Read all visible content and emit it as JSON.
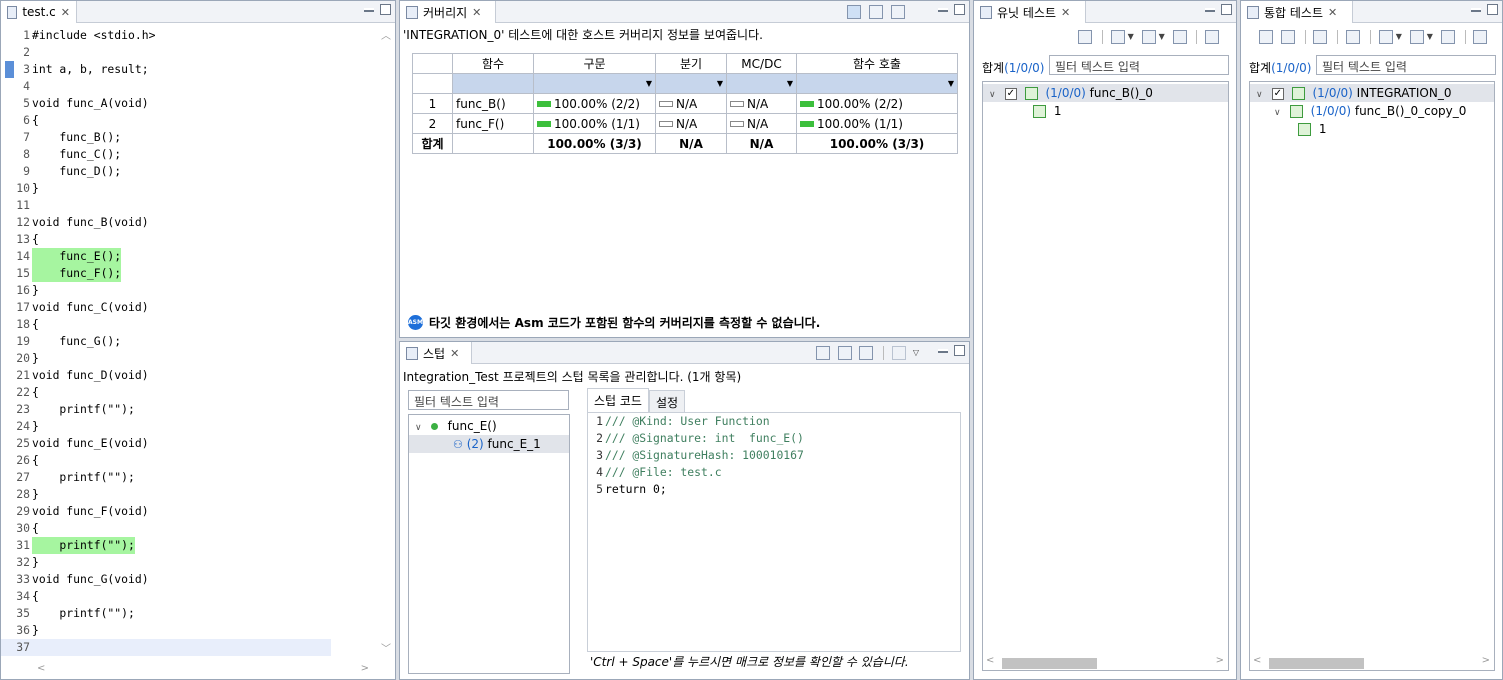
{
  "editor": {
    "tab_label": "test.c",
    "lines": [
      {
        "n": "1",
        "text": "#include <stdio.h>",
        "hl": false
      },
      {
        "n": "2",
        "text": "",
        "hl": false
      },
      {
        "n": "3",
        "text": "int a, b, result;",
        "hl": false
      },
      {
        "n": "4",
        "text": "",
        "hl": false
      },
      {
        "n": "5",
        "text": "void func_A(void)",
        "hl": false
      },
      {
        "n": "6",
        "text": "{",
        "hl": false
      },
      {
        "n": "7",
        "text": "    func_B();",
        "hl": false
      },
      {
        "n": "8",
        "text": "    func_C();",
        "hl": false
      },
      {
        "n": "9",
        "text": "    func_D();",
        "hl": false
      },
      {
        "n": "10",
        "text": "}",
        "hl": false
      },
      {
        "n": "11",
        "text": "",
        "hl": false
      },
      {
        "n": "12",
        "text": "void func_B(void)",
        "hl": false
      },
      {
        "n": "13",
        "text": "{",
        "hl": false
      },
      {
        "n": "14",
        "text": "    func_E();",
        "hl": true
      },
      {
        "n": "15",
        "text": "    func_F();",
        "hl": true
      },
      {
        "n": "16",
        "text": "}",
        "hl": false
      },
      {
        "n": "17",
        "text": "void func_C(void)",
        "hl": false
      },
      {
        "n": "18",
        "text": "{",
        "hl": false
      },
      {
        "n": "19",
        "text": "    func_G();",
        "hl": false
      },
      {
        "n": "20",
        "text": "}",
        "hl": false
      },
      {
        "n": "21",
        "text": "void func_D(void)",
        "hl": false
      },
      {
        "n": "22",
        "text": "{",
        "hl": false
      },
      {
        "n": "23",
        "text": "    printf(\"\");",
        "hl": false
      },
      {
        "n": "24",
        "text": "}",
        "hl": false
      },
      {
        "n": "25",
        "text": "void func_E(void)",
        "hl": false
      },
      {
        "n": "26",
        "text": "{",
        "hl": false
      },
      {
        "n": "27",
        "text": "    printf(\"\");",
        "hl": false
      },
      {
        "n": "28",
        "text": "}",
        "hl": false
      },
      {
        "n": "29",
        "text": "void func_F(void)",
        "hl": false
      },
      {
        "n": "30",
        "text": "{",
        "hl": false
      },
      {
        "n": "31",
        "text": "    printf(\"\");",
        "hl": true
      },
      {
        "n": "32",
        "text": "}",
        "hl": false
      },
      {
        "n": "33",
        "text": "void func_G(void)",
        "hl": false
      },
      {
        "n": "34",
        "text": "{",
        "hl": false
      },
      {
        "n": "35",
        "text": "    printf(\"\");",
        "hl": false
      },
      {
        "n": "36",
        "text": "}",
        "hl": false
      },
      {
        "n": "37",
        "text": "",
        "hl": false
      }
    ]
  },
  "coverage": {
    "tab_label": "커버리지",
    "description": "'INTEGRATION_0' 테스트에 대한 호스트 커버리지 정보를 보여줍니다.",
    "columns": [
      "함수",
      "구문",
      "분기",
      "MC/DC",
      "함수 호출"
    ],
    "rows": [
      {
        "idx": "1",
        "func": "func_B()",
        "stmt": "100.00% (2/2)",
        "branch": "N/A",
        "mcdc": "N/A",
        "call": "100.00% (2/2)"
      },
      {
        "idx": "2",
        "func": "func_F()",
        "stmt": "100.00% (1/1)",
        "branch": "N/A",
        "mcdc": "N/A",
        "call": "100.00% (1/1)"
      }
    ],
    "total": {
      "label": "합계",
      "stmt": "100.00% (3/3)",
      "branch": "N/A",
      "mcdc": "N/A",
      "call": "100.00% (3/3)"
    },
    "note": "타깃 환경에서는 Asm 코드가 포함된 함수의 커버리지를 측정할 수 없습니다.",
    "note_icon_text": "ASM"
  },
  "stub": {
    "tab_label": "스텁",
    "description": "Integration_Test 프로젝트의 스텁 목록을 관리합니다. (1개 항목)",
    "filter_placeholder": "필터 텍스트 입력",
    "tree": {
      "parent": "func_E()",
      "child_count": "(2)",
      "child": "func_E_1"
    },
    "subtabs": [
      "스텁 코드",
      "설정"
    ],
    "code": [
      {
        "n": "1",
        "text": "/// @Kind: User Function",
        "comment": true
      },
      {
        "n": "2",
        "text": "/// @Signature: int  func_E()",
        "comment": true
      },
      {
        "n": "3",
        "text": "/// @SignatureHash: 100010167",
        "comment": true
      },
      {
        "n": "4",
        "text": "/// @File: test.c",
        "comment": true
      },
      {
        "n": "5",
        "text": "return 0;",
        "comment": false
      }
    ],
    "hint": "'Ctrl + Space'를 누르시면 매크로 정보를 확인할 수 있습니다."
  },
  "unit_test": {
    "tab_label": "유닛 테스트",
    "summary_label": "합계",
    "summary_counts": "(1/0/0)",
    "filter_placeholder": "필터 텍스트 입력",
    "tree": {
      "root_counts": "(1/0/0)",
      "root": "func_B()_0",
      "child": "1"
    }
  },
  "integration_test": {
    "tab_label": "통합 테스트",
    "summary_label": "합계",
    "summary_counts": "(1/0/0)",
    "filter_placeholder": "필터 텍스트 입력",
    "tree": {
      "root_counts": "(1/0/0)",
      "root": "INTEGRATION_0",
      "mid_counts": "(1/0/0)",
      "mid": "func_B()_0_copy_0",
      "child": "1"
    }
  },
  "colors": {
    "covered": "#a6f5a0",
    "bar": "#3cbf3c",
    "filter_row": "#c7d6ec",
    "accent": "#1a63c8"
  }
}
